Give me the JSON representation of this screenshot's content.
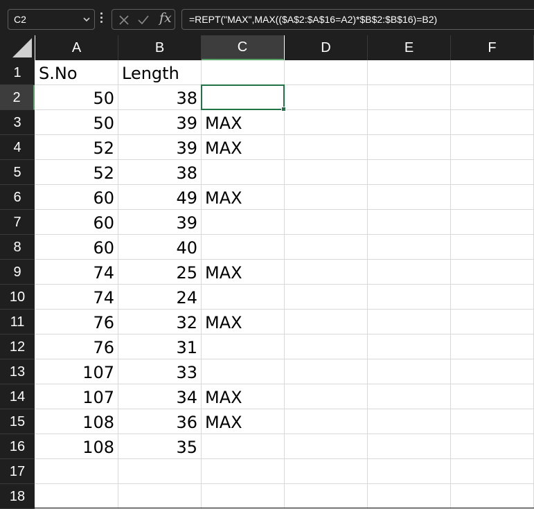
{
  "formula_bar": {
    "name_box": "C2",
    "formula": "=REPT(\"MAX\",MAX(($A$2:$A$16=A2)*$B$2:$B$16)=B2)",
    "fx_label": "fx"
  },
  "columns": [
    "A",
    "B",
    "C",
    "D",
    "E",
    "F"
  ],
  "rows": [
    "1",
    "2",
    "3",
    "4",
    "5",
    "6",
    "7",
    "8",
    "9",
    "10",
    "11",
    "12",
    "13",
    "14",
    "15",
    "16",
    "17",
    "18"
  ],
  "sheet": {
    "headers": {
      "A1": "S.No",
      "B1": "Length"
    },
    "data": [
      {
        "a": "50",
        "b": "38",
        "c": ""
      },
      {
        "a": "50",
        "b": "39",
        "c": "MAX"
      },
      {
        "a": "52",
        "b": "39",
        "c": "MAX"
      },
      {
        "a": "52",
        "b": "38",
        "c": ""
      },
      {
        "a": "60",
        "b": "49",
        "c": "MAX"
      },
      {
        "a": "60",
        "b": "39",
        "c": ""
      },
      {
        "a": "60",
        "b": "40",
        "c": ""
      },
      {
        "a": "74",
        "b": "25",
        "c": "MAX"
      },
      {
        "a": "74",
        "b": "24",
        "c": ""
      },
      {
        "a": "76",
        "b": "32",
        "c": "MAX"
      },
      {
        "a": "76",
        "b": "31",
        "c": ""
      },
      {
        "a": "107",
        "b": "33",
        "c": ""
      },
      {
        "a": "107",
        "b": "34",
        "c": "MAX"
      },
      {
        "a": "108",
        "b": "36",
        "c": "MAX"
      },
      {
        "a": "108",
        "b": "35",
        "c": ""
      }
    ]
  },
  "active_cell": "C2",
  "colors": {
    "accent": "#217346",
    "header_bg": "#1f1f1f",
    "gridline": "#d9d9d9"
  }
}
